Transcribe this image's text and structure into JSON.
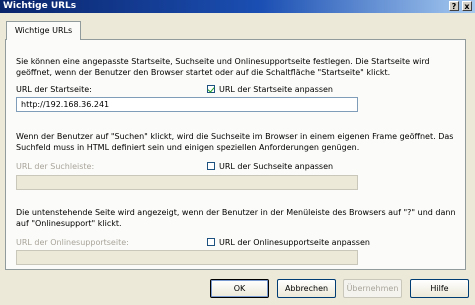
{
  "window": {
    "title": "Wichtige URLs",
    "help_btn": "?",
    "close_btn": "x"
  },
  "tab": {
    "label": "Wichtige URLs"
  },
  "startseite": {
    "description": "Sie können eine angepasste Startseite, Suchseite und Onlinesupportseite festlegen. Die Startseite wird geöffnet, wenn der Benutzer den Browser startet oder auf die Schaltfläche \"Startseite\" klickt.",
    "label": "URL der Startseite:",
    "checkbox_label": "URL der Startseite anpassen",
    "checked": true,
    "value": "http://192.168.36.241"
  },
  "suchleiste": {
    "description": "Wenn der Benutzer auf \"Suchen\" klickt, wird die Suchseite im Browser in einem eigenen Frame geöffnet. Das Suchfeld muss in HTML definiert sein und einigen speziellen Anforderungen genügen.",
    "label": "URL der Suchleiste:",
    "checkbox_label": "URL der Suchseite anpassen",
    "checked": false,
    "value": ""
  },
  "onlinesupport": {
    "description": "Die untenstehende Seite wird angezeigt, wenn der Benutzer in der Menüleiste des Browsers auf \"?\" und dann auf \"Onlinesupport\" klickt.",
    "label": "URL der Onlinesupportseite:",
    "checkbox_label": "URL der Onlinesupportseite anpassen",
    "checked": false,
    "value": ""
  },
  "buttons": {
    "ok": "OK",
    "cancel": "Abbrechen",
    "apply": "Übernehmen",
    "help": "Hilfe"
  }
}
